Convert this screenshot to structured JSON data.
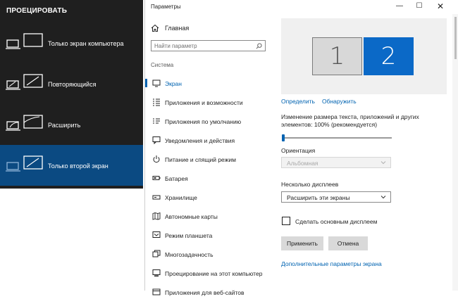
{
  "project": {
    "header": "ПРОЕЦИРОВАТЬ",
    "items": [
      {
        "label": "Только экран компьютера",
        "icon": "pc-screen-only-icon",
        "selected": false
      },
      {
        "label": "Повторяющийся",
        "icon": "duplicate-icon",
        "selected": false
      },
      {
        "label": "Расширить",
        "icon": "extend-icon",
        "selected": false
      },
      {
        "label": "Только второй экран",
        "icon": "second-screen-only-icon",
        "selected": true
      }
    ]
  },
  "window": {
    "title": "Параметры",
    "controls": {
      "minimize": "—",
      "maximize": "☐",
      "close": "✕"
    }
  },
  "nav": {
    "home": "Главная",
    "search_placeholder": "Найти параметр",
    "group": "Система",
    "items": [
      {
        "label": "Экран",
        "icon": "display-icon",
        "active": true
      },
      {
        "label": "Приложения и возможности",
        "icon": "apps-features-icon",
        "active": false
      },
      {
        "label": "Приложения по умолчанию",
        "icon": "default-apps-icon",
        "active": false
      },
      {
        "label": "Уведомления и действия",
        "icon": "notifications-icon",
        "active": false
      },
      {
        "label": "Питание и спящий режим",
        "icon": "power-icon",
        "active": false
      },
      {
        "label": "Батарея",
        "icon": "battery-icon",
        "active": false
      },
      {
        "label": "Хранилище",
        "icon": "storage-icon",
        "active": false
      },
      {
        "label": "Автономные карты",
        "icon": "offline-maps-icon",
        "active": false
      },
      {
        "label": "Режим планшета",
        "icon": "tablet-mode-icon",
        "active": false
      },
      {
        "label": "Многозадачность",
        "icon": "multitasking-icon",
        "active": false
      },
      {
        "label": "Проецирование на этот компьютер",
        "icon": "projecting-icon",
        "active": false
      },
      {
        "label": "Приложения для веб-сайтов",
        "icon": "web-apps-icon",
        "active": false
      }
    ]
  },
  "display": {
    "monitors": [
      {
        "number": "1",
        "selected": false
      },
      {
        "number": "2",
        "selected": true
      }
    ],
    "identify": "Определить",
    "detect": "Обнаружить",
    "scale_label": "Изменение размера текста, приложений и других элементов: 100% (рекомендуется)",
    "scale_value": 100,
    "orientation_label": "Ориентация",
    "orientation_value": "Альбомная",
    "multi_label": "Несколько дисплеев",
    "multi_value": "Расширить эти экраны",
    "primary_checkbox_label": "Сделать основным дисплеем",
    "primary_checked": false,
    "apply": "Применить",
    "cancel": "Отмена",
    "advanced_link": "Дополнительные параметры экрана"
  },
  "colors": {
    "accent": "#0063b1",
    "flyout_bg": "#1f1f1f",
    "flyout_selected": "#0b4a82",
    "monitor_selected": "#0b69c7"
  }
}
